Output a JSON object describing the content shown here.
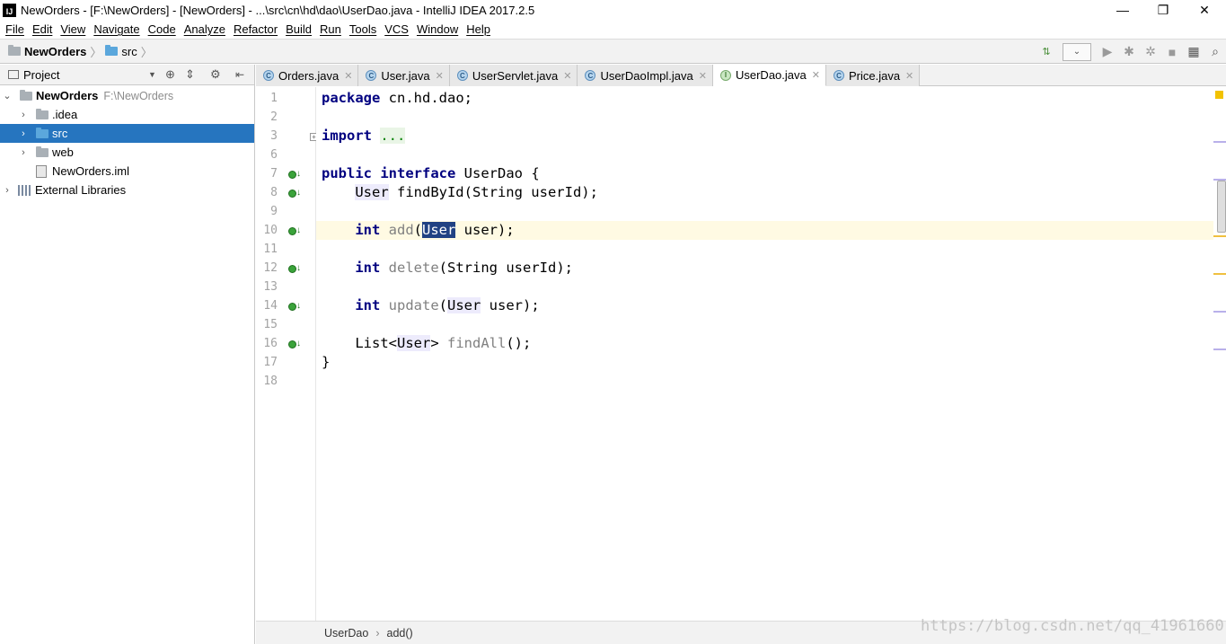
{
  "window": {
    "logo_text": "IJ",
    "title": "NewOrders - [F:\\NewOrders] - [NewOrders] - ...\\src\\cn\\hd\\dao\\UserDao.java - IntelliJ IDEA 2017.2.5",
    "minimize": "—",
    "restore": "❐",
    "close": "✕"
  },
  "menu": [
    "File",
    "Edit",
    "View",
    "Navigate",
    "Code",
    "Analyze",
    "Refactor",
    "Build",
    "Run",
    "Tools",
    "VCS",
    "Window",
    "Help"
  ],
  "navbar": {
    "project": "NewOrders",
    "folder": "src"
  },
  "project_panel": {
    "title": "Project",
    "tree": [
      {
        "label": "NewOrders",
        "path": "F:\\NewOrders"
      },
      {
        "label": ".idea"
      },
      {
        "label": "src"
      },
      {
        "label": "web"
      },
      {
        "label": "NewOrders.iml"
      },
      {
        "label": "External Libraries"
      }
    ]
  },
  "tabs": [
    {
      "label": "Orders.java",
      "kind": "class"
    },
    {
      "label": "User.java",
      "kind": "class"
    },
    {
      "label": "UserServlet.java",
      "kind": "class"
    },
    {
      "label": "UserDaoImpl.java",
      "kind": "class"
    },
    {
      "label": "UserDao.java",
      "kind": "interface",
      "active": true
    },
    {
      "label": "Price.java",
      "kind": "class"
    }
  ],
  "tab_icons": {
    "class": "C",
    "interface": "I"
  },
  "code": {
    "line_numbers": [
      "1",
      "2",
      "3",
      "6",
      "7",
      "8",
      "9",
      "10",
      "11",
      "12",
      "13",
      "14",
      "15",
      "16",
      "17",
      "18"
    ],
    "current_line": "10",
    "l1": {
      "kw": "package",
      "rest": " cn.hd.dao;"
    },
    "l3": {
      "kw": "import",
      "sp": " ",
      "folded": "..."
    },
    "l7": {
      "kw1": "public",
      "kw2": "interface",
      "rest": " UserDao {"
    },
    "l8": {
      "indent": "    ",
      "type": "User",
      "rest": " findById(String userId);"
    },
    "l10": {
      "indent": "    ",
      "kw": "int",
      "sp": " ",
      "name": "add",
      "open": "(",
      "type": "User",
      "rest": " user);"
    },
    "l12": {
      "indent": "    ",
      "kw": "int",
      "sp": " ",
      "name": "delete",
      "rest": "(String userId);"
    },
    "l14": {
      "indent": "    ",
      "kw": "int",
      "sp": " ",
      "name": "update",
      "open": "(",
      "type": "User",
      "rest": " user);"
    },
    "l16": {
      "indent": "    ",
      "pre": "List<",
      "type": "User",
      "mid": "> ",
      "name": "findAll",
      "rest": "();"
    },
    "l17": {
      "text": "}"
    }
  },
  "breadcrumb": {
    "class": "UserDao",
    "method": "add()"
  },
  "watermark": "https://blog.csdn.net/qq_41961660",
  "colors": {
    "selection": "#2675bf",
    "keyword": "#000080",
    "current_line": "#fffae3"
  }
}
